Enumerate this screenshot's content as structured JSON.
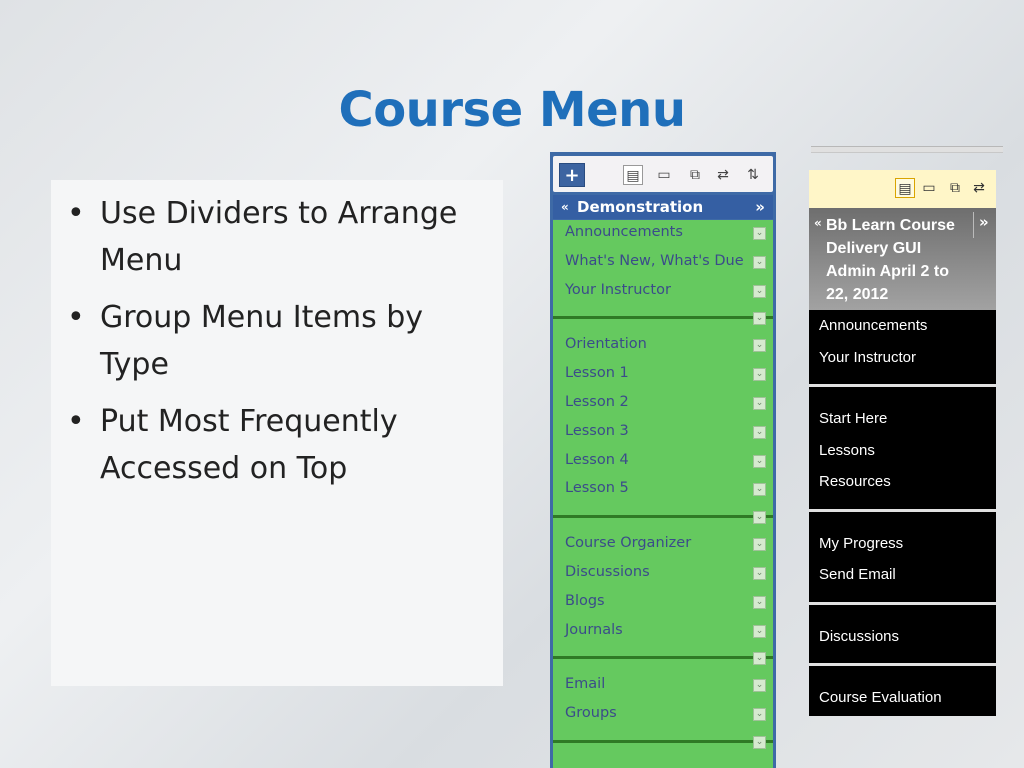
{
  "slide": {
    "title": "Course Menu",
    "bullets": [
      "Use Dividers to Arrange Menu",
      "Group Menu Items by Type",
      "Put Most Frequently Accessed on Top"
    ]
  },
  "menu_green": {
    "add_icon": "+",
    "toolbar_icons": [
      "list-view-icon",
      "folder-view-icon",
      "window-icon",
      "refresh-icon",
      "reorder-icon"
    ],
    "course_name": "Demonstration",
    "collapse_glyph": "«",
    "expand_glyph": "»",
    "groups": [
      [
        "Announcements",
        "What's New, What's Due",
        "Your Instructor"
      ],
      [
        "Orientation",
        "Lesson 1",
        "Lesson 2",
        "Lesson 3",
        "Lesson 4",
        "Lesson 5"
      ],
      [
        "Course Organizer",
        "Discussions",
        "Blogs",
        "Journals"
      ],
      [
        "Email",
        "Groups"
      ]
    ],
    "colors": {
      "header": "#355fa3",
      "list_bg": "#65c95f",
      "item_text": "#3b4c8a",
      "divider": "#2f7a25"
    }
  },
  "menu_black": {
    "toolbar_icons": [
      "list-view-icon",
      "folder-view-icon",
      "window-icon",
      "refresh-icon"
    ],
    "course_name": "Bb Learn Course Delivery GUI Admin April 2 to 22, 2012",
    "expand_glyph": "»",
    "groups": [
      [
        "Announcements",
        "Your Instructor"
      ],
      [
        "Start Here",
        "Lessons",
        "Resources"
      ],
      [
        "My Progress",
        "Send Email"
      ],
      [
        "Discussions"
      ],
      [
        "Course Evaluation"
      ]
    ],
    "colors": {
      "toolbar_bg": "#fff6c8",
      "list_bg": "#000000",
      "item_text": "#ffffff",
      "divider": "#e0e0e0"
    }
  }
}
